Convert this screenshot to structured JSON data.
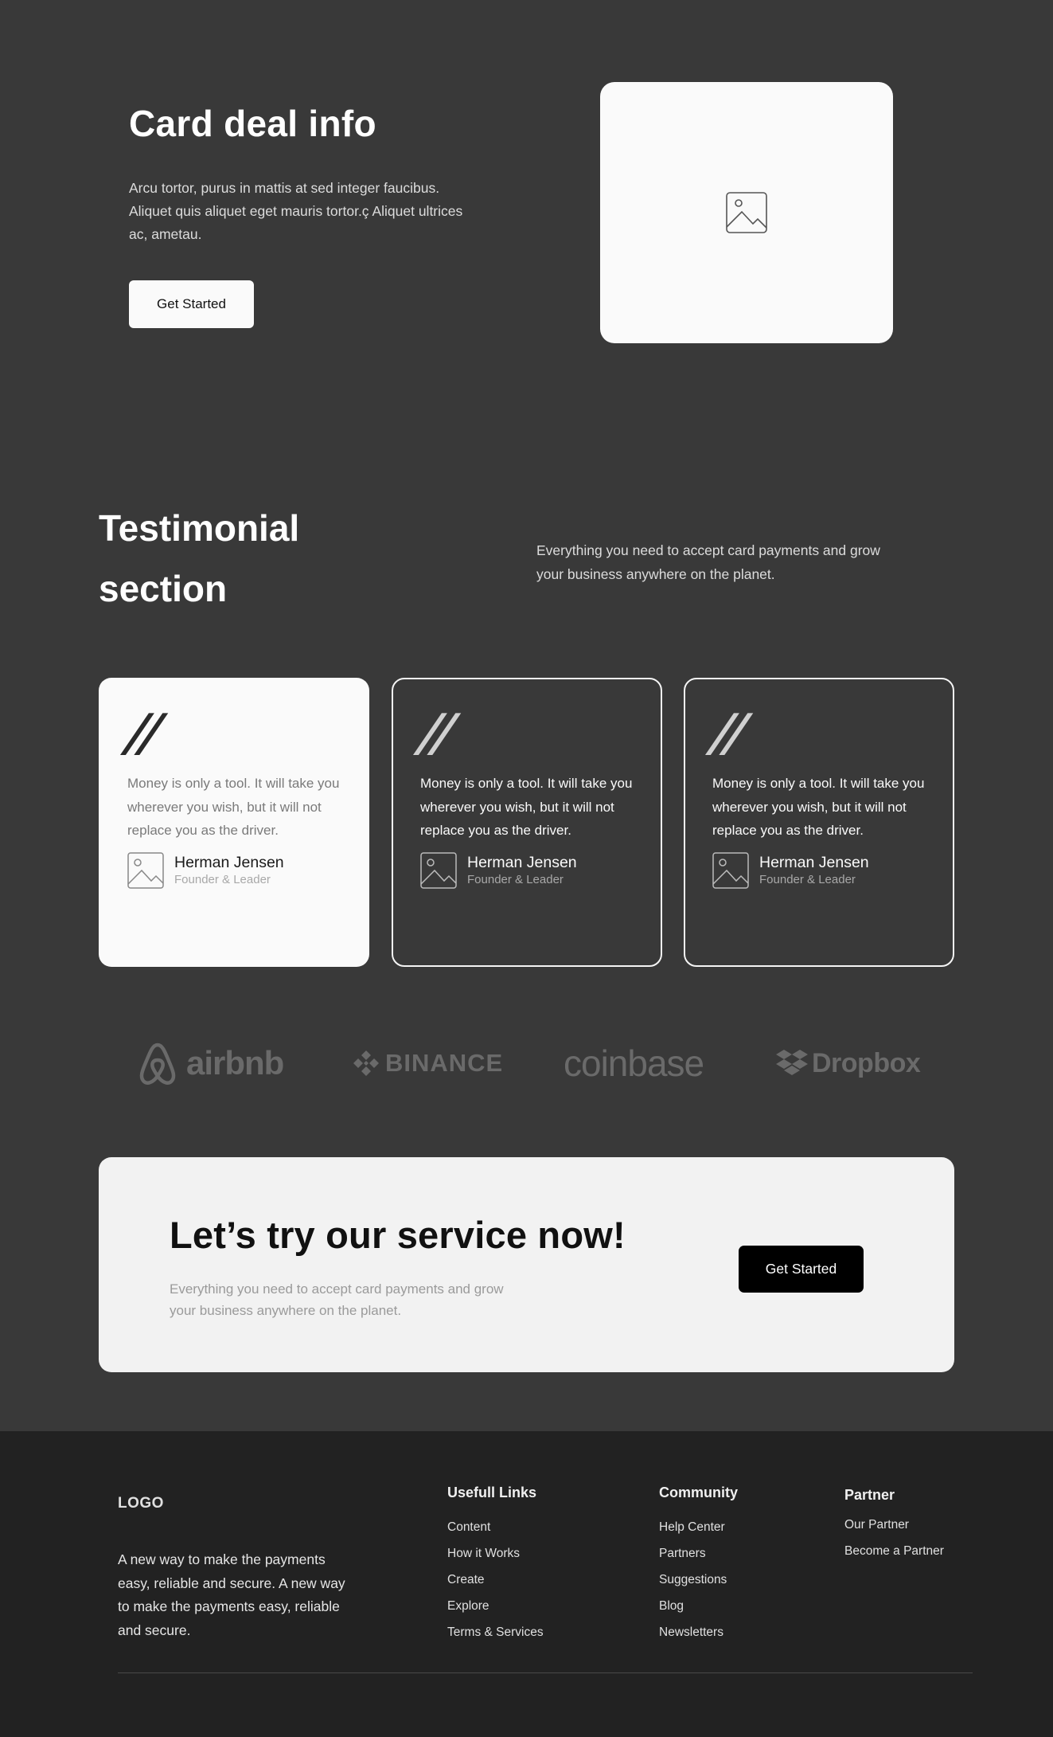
{
  "hero": {
    "title": "Card deal info",
    "text": "Arcu tortor, purus in mattis at sed integer faucibus. Aliquet quis aliquet eget mauris tortor.ç Aliquet ultrices ac, ametau.",
    "button_label": "Get Started",
    "image_icon": "image-placeholder-icon"
  },
  "testimonials": {
    "title": "Testimonial section",
    "subtitle": "Everything you need to accept card payments and grow your business anywhere on the planet.",
    "cards": [
      {
        "quote_mark": "”",
        "quote": "Money is only a tool. It will take you wherever you wish, but it will not replace you as the driver.",
        "name": "Herman Jensen",
        "role": "Founder & Leader",
        "style": "light"
      },
      {
        "quote_mark": "”",
        "quote": "Money is only a tool. It will take you wherever you wish, but it will not replace you as the driver.",
        "name": "Herman Jensen",
        "role": "Founder & Leader",
        "style": "dark"
      },
      {
        "quote_mark": "”",
        "quote": "Money is only a tool. It will take you wherever you wish, but it will not replace you as the driver.",
        "name": "Herman Jensen",
        "role": "Founder & Leader",
        "style": "dark"
      }
    ]
  },
  "logos": [
    {
      "name": "airbnb",
      "icon": "airbnb-logo-icon"
    },
    {
      "name": "BINANCE",
      "icon": "binance-logo-icon"
    },
    {
      "name": "coinbase",
      "icon": "coinbase-logo-icon"
    },
    {
      "name": "Dropbox",
      "icon": "dropbox-logo-icon"
    }
  ],
  "cta": {
    "title": "Let’s try our service now!",
    "text": "Everything you need to accept card payments and grow your business anywhere on the planet.",
    "button_label": "Get Started"
  },
  "footer": {
    "logo": "LOGO",
    "description": "A new way to make the payments easy, reliable and secure. A new way to make the payments easy, reliable and secure.",
    "columns": [
      {
        "title": "Usefull Links",
        "links": [
          "Content",
          "How it Works",
          "Create",
          "Explore",
          "Terms & Services"
        ]
      },
      {
        "title": "Community",
        "links": [
          "Help Center",
          "Partners",
          "Suggestions",
          "Blog",
          "Newsletters"
        ]
      },
      {
        "title": "Partner",
        "links": [
          "Our Partner",
          "Become a Partner"
        ]
      }
    ]
  },
  "colors": {
    "background": "#393939",
    "footer_background": "#222222",
    "light_card": "#fafafa",
    "cta_background": "#f2f2f2",
    "logo_gray": "#6a6a6a"
  }
}
